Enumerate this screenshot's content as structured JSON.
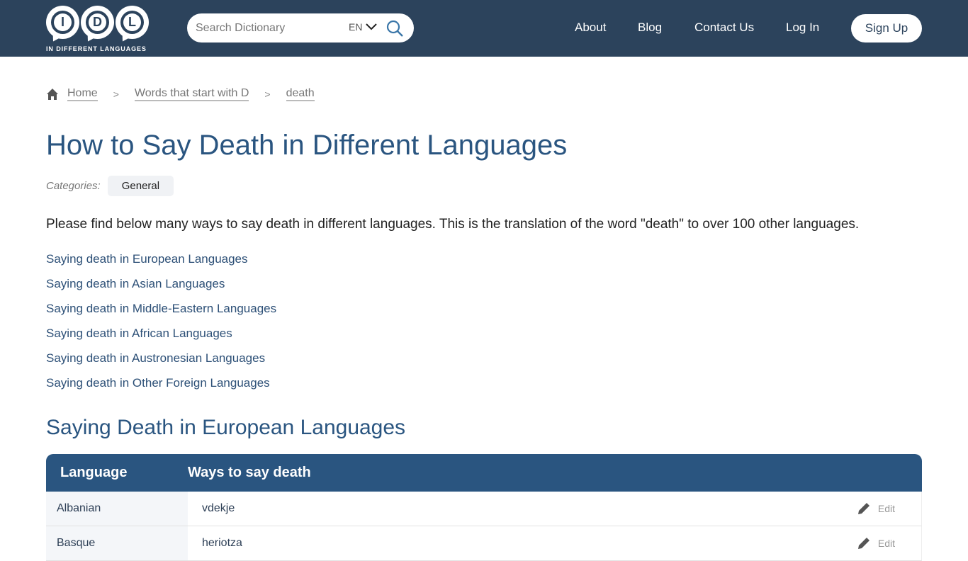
{
  "header": {
    "logo": {
      "letters": [
        "I",
        "D",
        "L"
      ],
      "tagline": "IN DIFFERENT LANGUAGES"
    },
    "search": {
      "placeholder": "Search Dictionary",
      "value": "",
      "language": "EN",
      "icon": "search-icon"
    },
    "nav": [
      "About",
      "Blog",
      "Contact Us",
      "Log In"
    ],
    "signup_label": "Sign Up"
  },
  "breadcrumb": {
    "items": [
      "Home",
      "Words that start with D",
      "death"
    ],
    "separator": ">"
  },
  "page": {
    "title": "How to Say Death in Different Languages",
    "categories_label": "Categories:",
    "categories": [
      "General"
    ],
    "intro": "Please find below many ways to say death in different languages. This is the translation of the word \"death\" to over 100 other languages.",
    "section_links": [
      "Saying death in European Languages",
      "Saying death in Asian Languages",
      "Saying death in Middle-Eastern Languages",
      "Saying death in African Languages",
      "Saying death in Austronesian Languages",
      "Saying death in Other Foreign Languages"
    ]
  },
  "section": {
    "title": "Saying Death in European Languages",
    "table": {
      "headers": [
        "Language",
        "Ways to say death"
      ],
      "edit_label": "Edit",
      "rows": [
        {
          "language": "Albanian",
          "translation": "vdekje"
        },
        {
          "language": "Basque",
          "translation": "heriotza"
        }
      ]
    }
  },
  "colors": {
    "header_bg": "#2c435c",
    "accent": "#2a5580",
    "link": "#2d5077"
  }
}
